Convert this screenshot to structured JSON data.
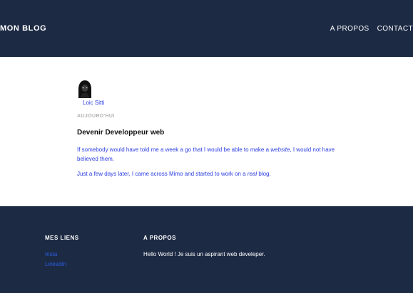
{
  "header": {
    "logo": "MON BLOG",
    "nav": [
      "A PROPOS",
      "CONTACT"
    ]
  },
  "post": {
    "author": "Loic Sitti",
    "date": "AUJOURD'HUI",
    "title": "Devenir Developpeur web",
    "p1_a": "If somebody would have told me a week a go that I would be able to make a ",
    "p1_em": "website",
    "p1_b": ", I would not have believed them.",
    "p2_a": "Just a few days later, I came across Mimo and started to work on a ",
    "p2_em": "real",
    "p2_b": " blog."
  },
  "footer": {
    "links_heading": "MES LIENS",
    "links": [
      "Insta",
      "LinkedIn"
    ],
    "about_heading": "A PROPOS",
    "about_text": "Hello World ! Je suis un aspirant web develeper."
  },
  "colors": {
    "header_bg": "#1c2a44",
    "link": "#2b3de0",
    "muted": "#b3b3b3"
  },
  "icons": {
    "avatar": "hooded-figure-avatar-icon"
  }
}
